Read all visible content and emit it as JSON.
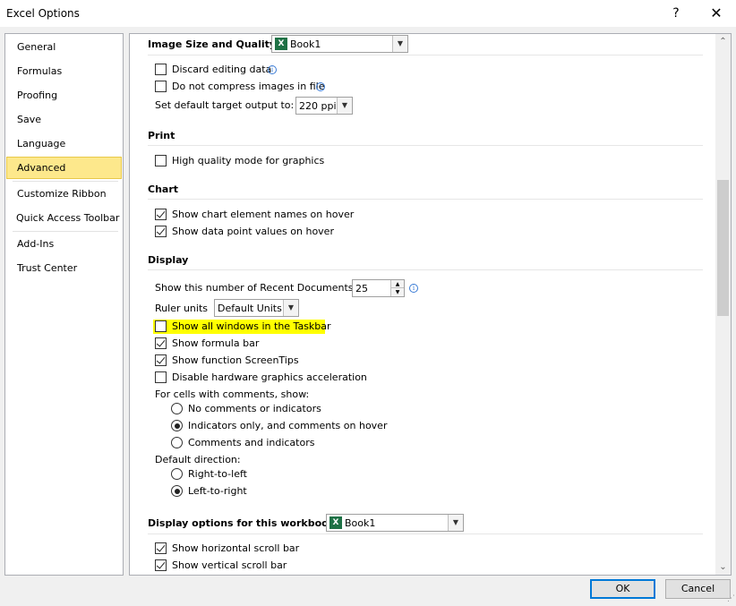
{
  "window": {
    "title": "Excel Options",
    "help": "?",
    "close": "✕"
  },
  "nav": {
    "items": [
      "General",
      "Formulas",
      "Proofing",
      "Save",
      "Language",
      "Advanced",
      "Customize Ribbon",
      "Quick Access Toolbar",
      "Add-Ins",
      "Trust Center"
    ],
    "selected": "Advanced"
  },
  "image": {
    "heading": "Image Size and Quality",
    "workbook": "Book1",
    "discard_editing": "Discard editing data",
    "no_compress": "Do not compress images in file",
    "target_output_label": "Set default target output to:",
    "target_output_value": "220 ppi"
  },
  "print": {
    "heading": "Print",
    "high_quality": "High quality mode for graphics"
  },
  "chart": {
    "heading": "Chart",
    "element_names": "Show chart element names on hover",
    "data_point_values": "Show data point values on hover"
  },
  "display": {
    "heading": "Display",
    "recent_docs_label": "Show this number of Recent Documents:",
    "recent_docs_value": "25",
    "ruler_label": "Ruler units",
    "ruler_value": "Default Units",
    "all_windows": "Show all windows in the Taskbar",
    "formula_bar": "Show formula bar",
    "screentips": "Show function ScreenTips",
    "disable_hw": "Disable hardware graphics acceleration",
    "comments_label": "For cells with comments, show:",
    "no_comments": "No comments or indicators",
    "indicators_only": "Indicators only, and comments on hover",
    "comments_and_indicators": "Comments and indicators",
    "direction_label": "Default direction:",
    "rtl": "Right-to-left",
    "ltr": "Left-to-right"
  },
  "workbook_display": {
    "heading": "Display options for this workbook:",
    "workbook": "Book1",
    "hscroll": "Show horizontal scroll bar",
    "vscroll": "Show vertical scroll bar"
  },
  "icons": {
    "excel": "X",
    "info": "i",
    "dropdown": "▼",
    "spin_up": "▲",
    "spin_down": "▼",
    "scroll_up": "⌃",
    "scroll_down": "⌄"
  },
  "colors": {
    "selected_nav": "#fde88c",
    "highlight": "#ffff00",
    "primary_border": "#0078d7",
    "excel_green": "#1e7145"
  },
  "buttons": {
    "ok": "OK",
    "cancel": "Cancel"
  }
}
